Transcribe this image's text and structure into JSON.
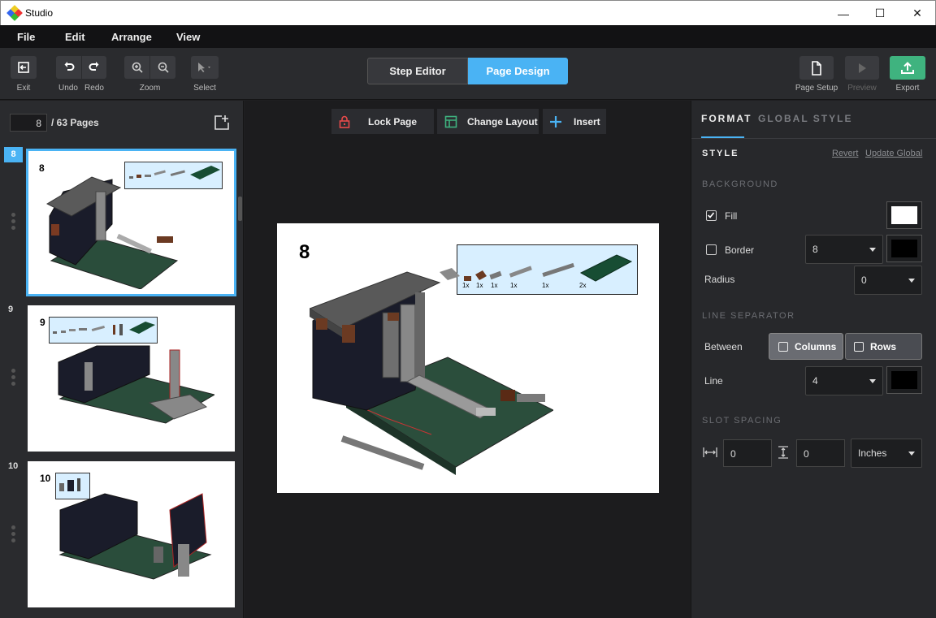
{
  "app": {
    "title": "Studio"
  },
  "window": {
    "minimize": "—",
    "maximize": "☐",
    "close": "✕"
  },
  "menu": [
    "File",
    "Edit",
    "Arrange",
    "View"
  ],
  "toolbar": {
    "exit": "Exit",
    "undo": "Undo",
    "redo": "Redo",
    "zoom": "Zoom",
    "select": "Select",
    "step_editor": "Step Editor",
    "page_design": "Page Design",
    "page_setup": "Page Setup",
    "preview": "Preview",
    "export": "Export"
  },
  "pages": {
    "current": "8",
    "total_label": "/ 63 Pages",
    "thumbs": [
      {
        "num": "8",
        "label": "8",
        "selected": true
      },
      {
        "num": "9",
        "label": "9",
        "selected": false
      },
      {
        "num": "10",
        "label": "10",
        "selected": false
      }
    ]
  },
  "canvas": {
    "lock_page": "Lock Page",
    "change_layout": "Change Layout",
    "insert": "Insert",
    "step_number": "8",
    "parts": [
      "1x",
      "1x",
      "1x",
      "1x",
      "1x",
      "2x"
    ]
  },
  "format": {
    "tab_format": "FORMAT",
    "tab_global": "GLOBAL STYLE",
    "style": "STYLE",
    "revert": "Revert",
    "update_global": "Update Global",
    "background": "BACKGROUND",
    "fill": "Fill",
    "border": "Border",
    "border_value": "8",
    "radius": "Radius",
    "radius_value": "0",
    "line_separator": "LINE SEPARATOR",
    "between": "Between",
    "columns": "Columns",
    "rows": "Rows",
    "line": "Line",
    "line_value": "4",
    "slot_spacing": "SLOT SPACING",
    "h_spacing": "0",
    "v_spacing": "0",
    "unit": "Inches",
    "fill_color": "#ffffff",
    "border_color": "#000000",
    "line_color": "#000000"
  },
  "colors": {
    "accent": "#4ab3f4",
    "export_green": "#3fb37f"
  }
}
